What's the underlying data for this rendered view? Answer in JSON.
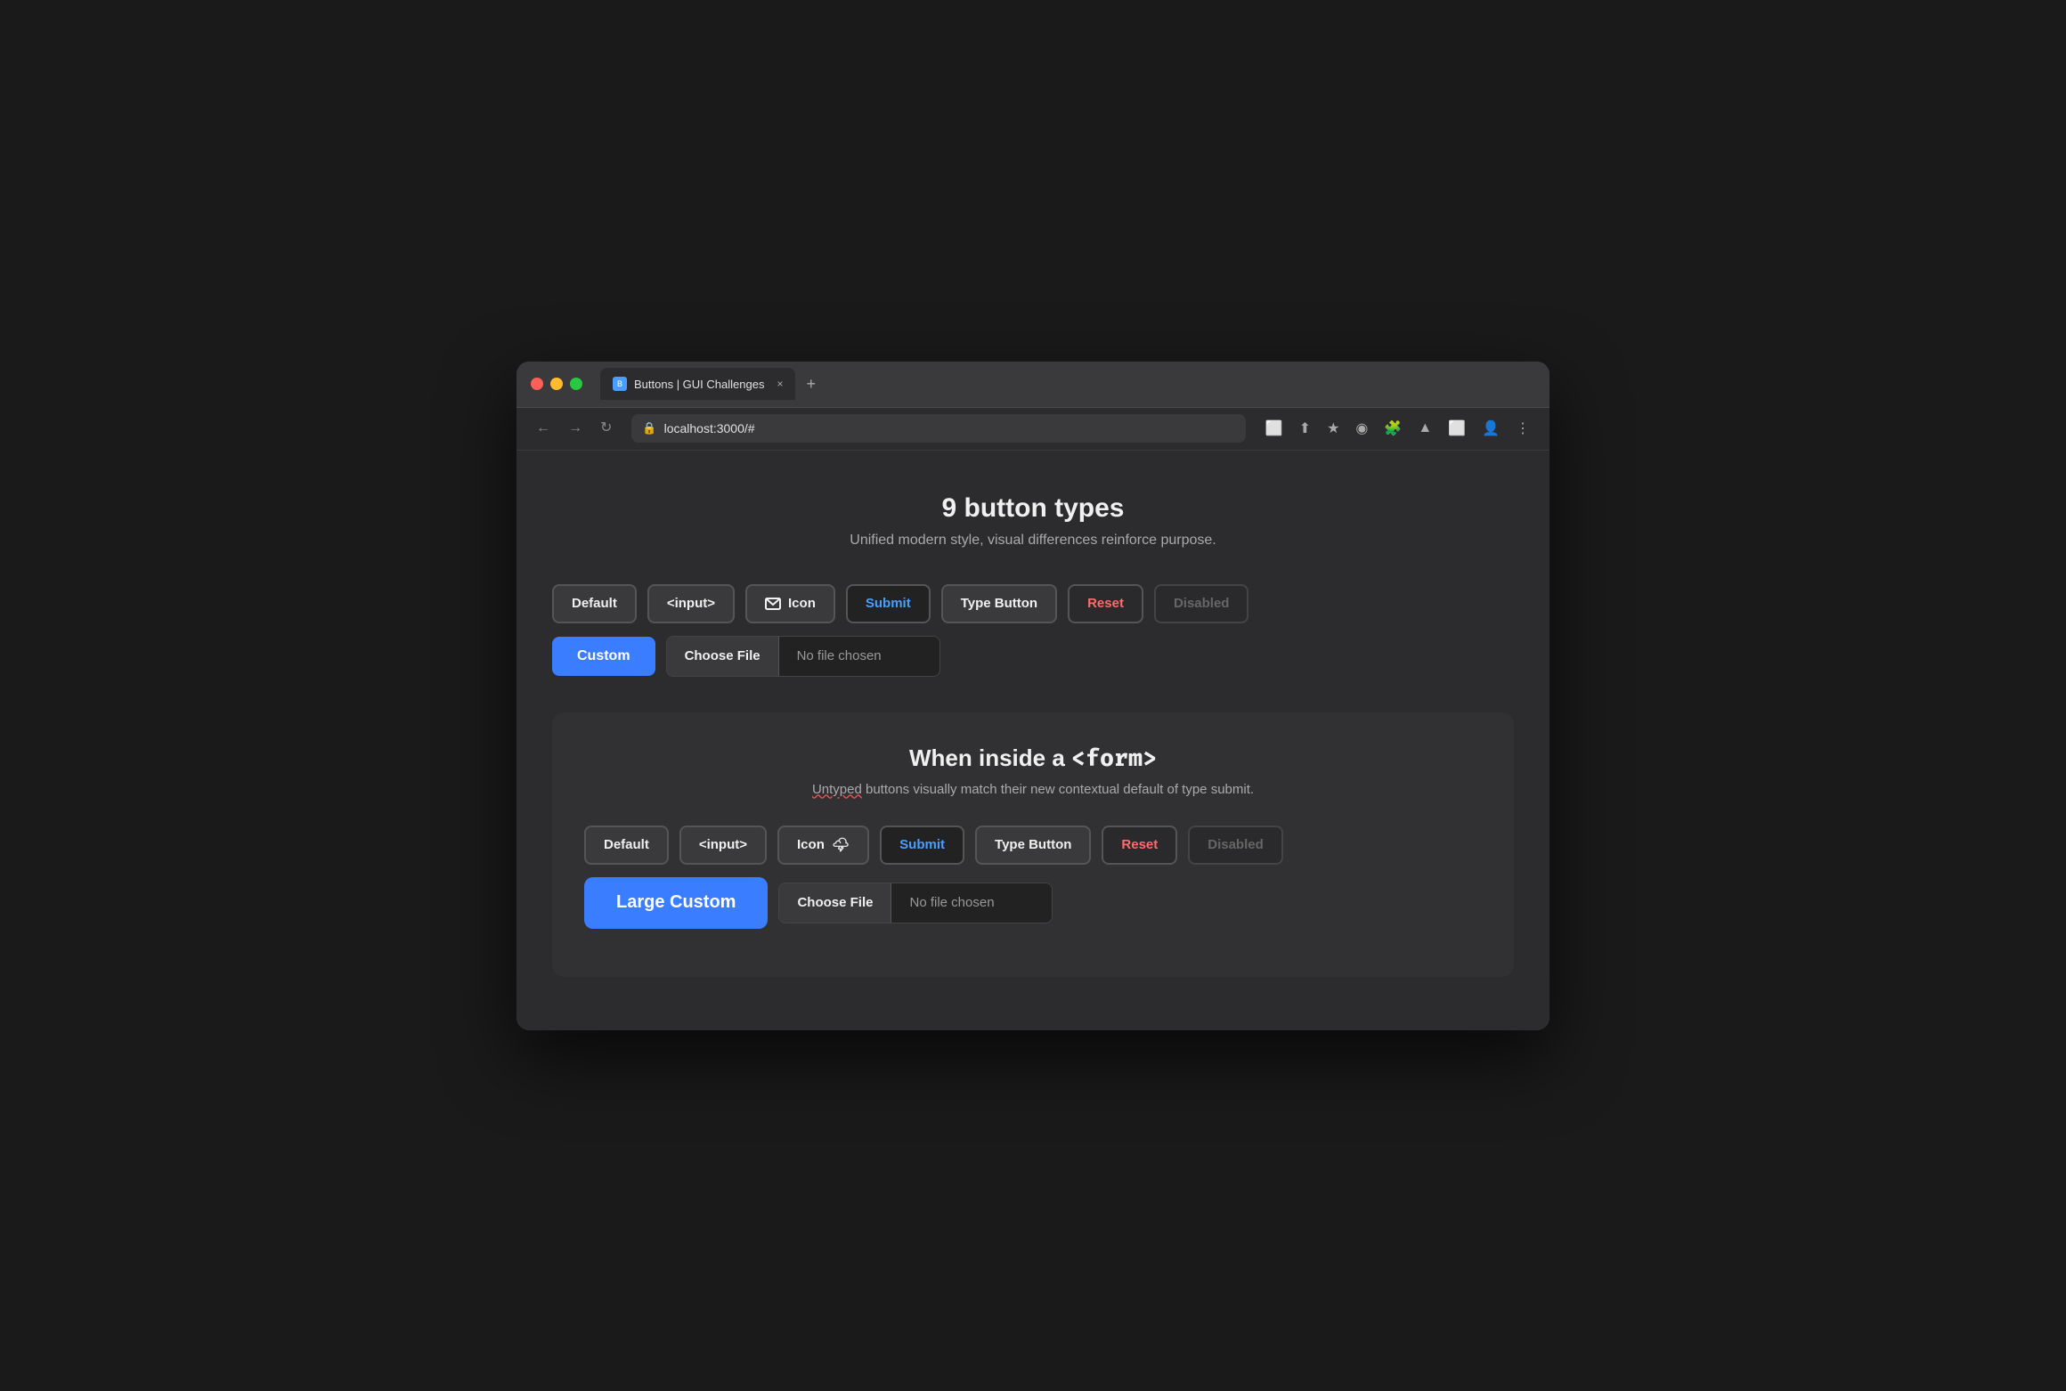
{
  "browser": {
    "tab_title": "Buttons | GUI Challenges",
    "tab_close": "×",
    "tab_add": "+",
    "url": "localhost:3000/#",
    "nav": {
      "back": "←",
      "forward": "→",
      "refresh": "↻"
    },
    "nav_actions": [
      "⬜",
      "⬆",
      "★",
      "◉",
      "🧩",
      "▲",
      "⬜",
      "👤",
      "⋮"
    ]
  },
  "page": {
    "title": "9 button types",
    "subtitle": "Unified modern style, visual differences reinforce purpose.",
    "top_section": {
      "buttons": [
        {
          "id": "default",
          "label": "Default"
        },
        {
          "id": "input",
          "label": "<input>"
        },
        {
          "id": "icon",
          "label": "Icon"
        },
        {
          "id": "submit",
          "label": "Submit"
        },
        {
          "id": "type-button",
          "label": "Type Button"
        },
        {
          "id": "reset",
          "label": "Reset"
        },
        {
          "id": "disabled",
          "label": "Disabled"
        }
      ],
      "custom_label": "Custom",
      "file_choose": "Choose File",
      "file_no_chosen": "No file chosen"
    },
    "form_section": {
      "title_prefix": "When inside a ",
      "title_code": "<form>",
      "subtitle_normal": " buttons visually match their new contextual default of type submit.",
      "subtitle_underlined": "Untyped",
      "buttons": [
        {
          "id": "default2",
          "label": "Default"
        },
        {
          "id": "input2",
          "label": "<input>"
        },
        {
          "id": "icon2",
          "label": "Icon"
        },
        {
          "id": "submit2",
          "label": "Submit"
        },
        {
          "id": "type-button2",
          "label": "Type Button"
        },
        {
          "id": "reset2",
          "label": "Reset"
        },
        {
          "id": "disabled2",
          "label": "Disabled"
        }
      ],
      "custom_label": "Large Custom",
      "file_choose": "Choose File",
      "file_no_chosen": "No file chosen"
    }
  }
}
